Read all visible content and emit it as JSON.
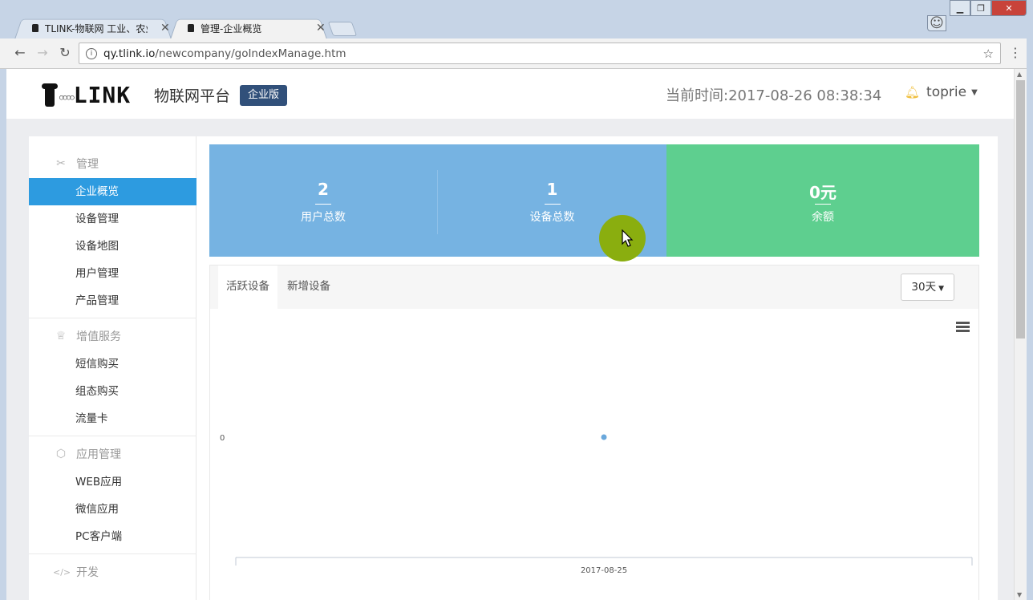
{
  "browser": {
    "tabs": [
      {
        "title": "TLINK-物联网 工业、农业",
        "active": false
      },
      {
        "title": "管理-企业概览",
        "active": true
      }
    ],
    "url_host": "qy.tlink.io",
    "url_path": "/newcompany/goIndexManage.htm"
  },
  "header": {
    "logo_text": "LINK",
    "logo_dots": "○○○○",
    "platform": "物联网平台",
    "edition": "企业版",
    "clock": "当前时间:2017-08-26 08:38:34",
    "user": "toprie"
  },
  "sidebar": {
    "groups": [
      {
        "title": "管理",
        "icon": "tools-icon",
        "items": [
          "企业概览",
          "设备管理",
          "设备地图",
          "用户管理",
          "产品管理"
        ]
      },
      {
        "title": "增值服务",
        "icon": "crown-icon",
        "items": [
          "短信购买",
          "组态购买",
          "流量卡"
        ]
      },
      {
        "title": "应用管理",
        "icon": "cube-icon",
        "items": [
          "WEB应用",
          "微信应用",
          "PC客户端"
        ]
      },
      {
        "title": "开发",
        "icon": "code-icon",
        "items": []
      }
    ],
    "active_item": "企业概览"
  },
  "stats": [
    {
      "value": "2",
      "label": "用户总数"
    },
    {
      "value": "1",
      "label": "设备总数"
    },
    {
      "value": "0元",
      "label": "余额"
    }
  ],
  "colors": {
    "stat_blue": "#76b3e2",
    "stat_green": "#5ecf8f",
    "active_nav": "#2d9be0",
    "edition_badge": "#31507a"
  },
  "panel": {
    "tabs": [
      "活跃设备",
      "新增设备"
    ],
    "active_tab": "活跃设备",
    "range": "30天"
  },
  "chart_data": {
    "type": "scatter",
    "x": [
      "2017-08-25"
    ],
    "y": [
      0
    ],
    "ytick_labels": [
      "0"
    ],
    "xtick_labels": [
      "2017-08-25"
    ],
    "grid": false
  }
}
